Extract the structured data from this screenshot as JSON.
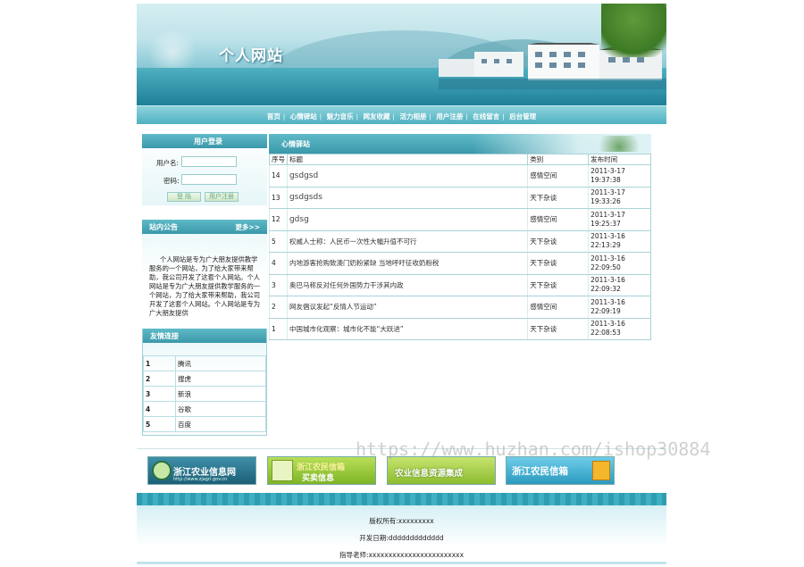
{
  "site": {
    "title": "个人网站"
  },
  "nav": {
    "items": [
      "首页",
      "心情驿站",
      "魅力音乐",
      "网友收藏",
      "活力相册",
      "用户注册",
      "在线留言",
      "后台管理"
    ],
    "separator": "|"
  },
  "login": {
    "title": "用户登录",
    "username_label": "用户名:",
    "password_label": "密码:",
    "login_button": "登 陆",
    "register_button": "用户注册"
  },
  "notice": {
    "title": "站内公告",
    "more": "更多>>",
    "text": "个人网站是专为广大朋友提供教学服务的一个网站，为了给大家带来帮助，我公司开发了这套个人网站。个人网站是专为广大朋友提供教学服务的一个网站，为了给大家带来帮助，我公司开发了这套个人网站。个人网站是专为广大朋友提供"
  },
  "links": {
    "title": "友情连接",
    "items": [
      {
        "num": "1",
        "name": "腾讯"
      },
      {
        "num": "2",
        "name": "搜虎"
      },
      {
        "num": "3",
        "name": "新浪"
      },
      {
        "num": "4",
        "name": "谷歌"
      },
      {
        "num": "5",
        "name": "百度"
      }
    ]
  },
  "main": {
    "title": "心情驿站",
    "columns": [
      "序号",
      "标题",
      "类别",
      "发布时间"
    ],
    "rows": [
      {
        "id": "14",
        "title": "gsdgsd",
        "category": "感情空间",
        "date": "2011-3-17",
        "time": "19:37:38"
      },
      {
        "id": "13",
        "title": "gsdgsds",
        "category": "天下杂谈",
        "date": "2011-3-17",
        "time": "19:33:26"
      },
      {
        "id": "12",
        "title": "gdsg",
        "category": "感情空间",
        "date": "2011-3-17",
        "time": "19:25:37"
      },
      {
        "id": "5",
        "title": "权威人士称：人民币一次性大幅升值不可行",
        "category": "天下杂谈",
        "date": "2011-3-16",
        "time": "22:13:29"
      },
      {
        "id": "4",
        "title": "内地游客抢购致澳门奶粉紧缺 当地呼吁征收奶粉税",
        "category": "天下杂谈",
        "date": "2011-3-16",
        "time": "22:09:50"
      },
      {
        "id": "3",
        "title": "奥巴马称反对任何外国势力干涉其内政",
        "category": "天下杂谈",
        "date": "2011-3-16",
        "time": "22:09:32"
      },
      {
        "id": "2",
        "title": "网友倡议发起“反情人节运动”",
        "category": "感情空间",
        "date": "2011-3-16",
        "time": "22:09:19"
      },
      {
        "id": "1",
        "title": "中国城市化观察：城市化不能“大跃进”",
        "category": "天下杂谈",
        "date": "2011-3-16",
        "time": "22:08:53"
      }
    ]
  },
  "partners": {
    "logo1": {
      "text": "浙江农业信息网",
      "sub": "http://www.zjagri.gov.cn"
    },
    "logo2": {
      "line1": "浙江农民信箱",
      "line2": "买卖信息"
    },
    "logo3": {
      "text": "农业信息资源集成"
    },
    "logo4": {
      "text": "浙江农民信箱"
    }
  },
  "footer": {
    "copyright": "版权所有:xxxxxxxxx",
    "dev_date": "开发日期:ddddddddddddd",
    "advisor": "指导老师:xxxxxxxxxxxxxxxxxxxxxxxx"
  },
  "watermark": "https://www.huzhan.com/ishop30884",
  "colors": {
    "accent": "#3a98aa",
    "nav_bg": "#4fb1c1",
    "link_text": "#333333"
  }
}
